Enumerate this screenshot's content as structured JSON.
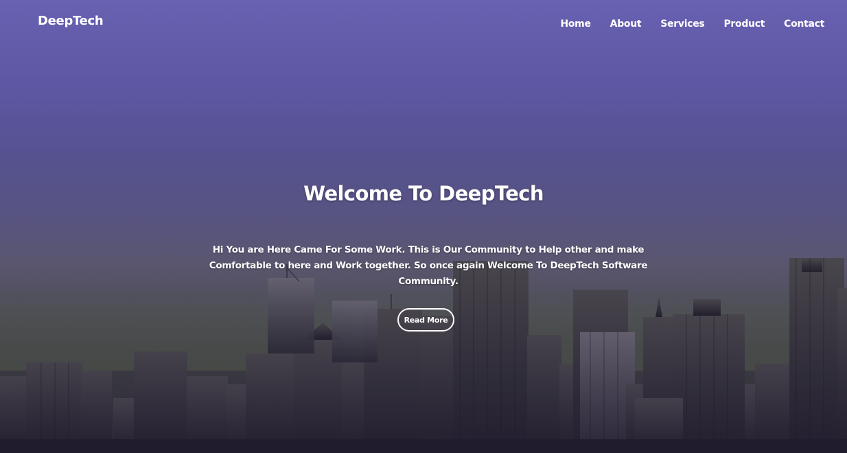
{
  "brand": {
    "name": "DeepTech"
  },
  "nav": {
    "items": [
      {
        "label": "Home"
      },
      {
        "label": "About"
      },
      {
        "label": "Services"
      },
      {
        "label": "Product"
      },
      {
        "label": "Contact"
      }
    ]
  },
  "hero": {
    "title": "Welcome To DeepTech",
    "text": "Hi You are Here Came For Some Work. This is Our Community to Help other and make Comfortable to here and Work together. So once again Welcome To DeepTech Software Community.",
    "button_label": "Read More",
    "background": "city-skyline-photo",
    "overlay_color": "#5a55a8"
  }
}
